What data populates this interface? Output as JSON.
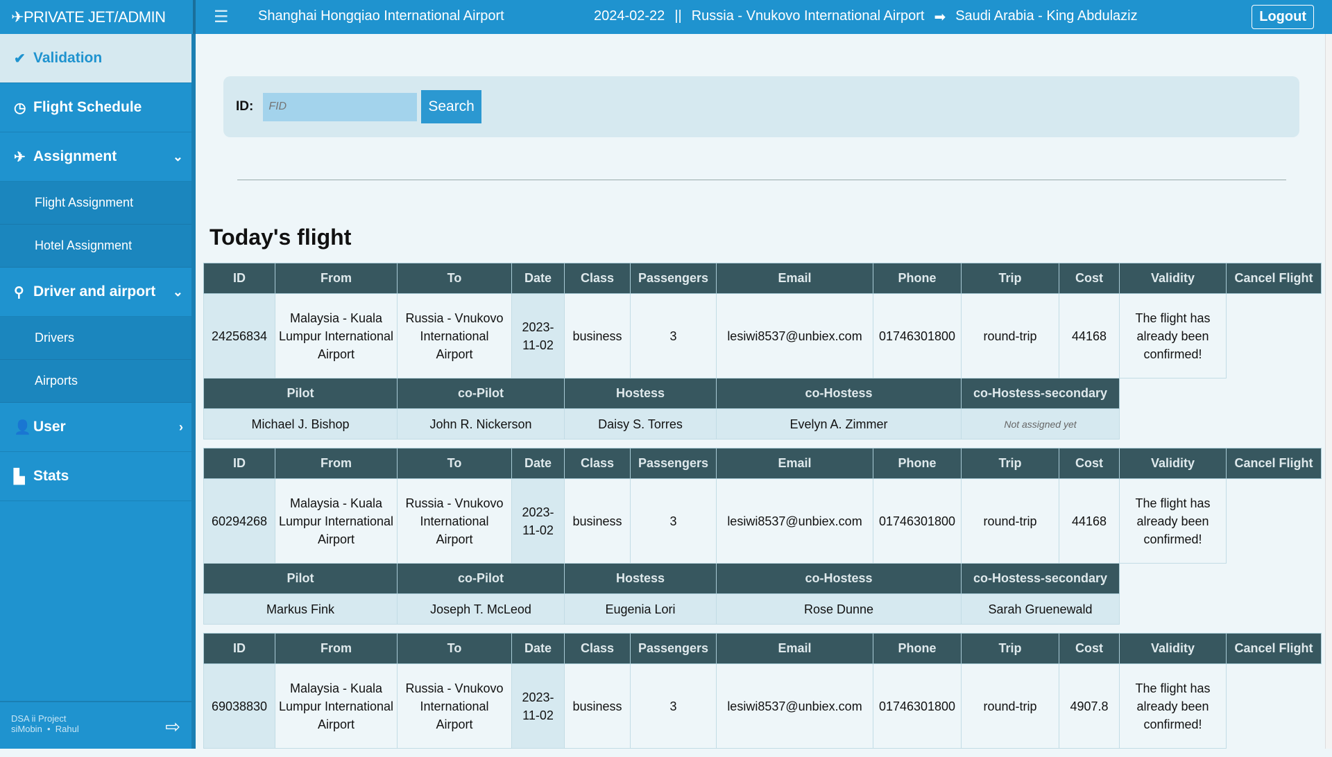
{
  "header": {
    "brand": "PRIVATE JET/ADMIN",
    "brand_icon": "plane-lock-icon",
    "menu_icon": "hamburger-icon",
    "departure": "Shanghai Hongqiao International Airport",
    "date": "2024-02-22",
    "separator": "||",
    "origin": "Russia - Vnukovo International Airport",
    "arrow": "➡",
    "destination": "Saudi Arabia - King Abdulaziz",
    "logout": "Logout"
  },
  "sidebar": {
    "items": [
      {
        "label": "Validation",
        "icon": "check-circle-icon",
        "active": true
      },
      {
        "label": "Flight Schedule",
        "icon": "clock-icon"
      },
      {
        "label": "Assignment",
        "icon": "plane-icon",
        "chevron": "⌄",
        "subitems": [
          "Flight Assignment",
          "Hotel Assignment"
        ]
      },
      {
        "label": "Driver and airport",
        "icon": "map-pin-icon",
        "chevron": "⌄",
        "subitems": [
          "Drivers",
          "Airports"
        ]
      },
      {
        "label": "User",
        "icon": "user-icon",
        "chevron": "›"
      },
      {
        "label": "Stats",
        "icon": "chart-icon"
      }
    ],
    "footer": {
      "project": "DSA ii Project",
      "authors": "siMobin  •  Rahul",
      "icon": "sign-out-icon"
    }
  },
  "search": {
    "label": "ID:",
    "placeholder": "FID",
    "button": "Search"
  },
  "section_title": "Today's flight",
  "columns": [
    "ID",
    "From",
    "To",
    "Date",
    "Class",
    "Passengers",
    "Email",
    "Phone",
    "Trip",
    "Cost",
    "Validity",
    "Cancel Flight"
  ],
  "crew_columns": [
    "Pilot",
    "co-Pilot",
    "Hostess",
    "co-Hostess",
    "co-Hostess-secondary"
  ],
  "flights": [
    {
      "cells": [
        "24256834",
        "Malaysia - Kuala Lumpur International Airport",
        "Russia - Vnukovo International Airport",
        "2023-11-02",
        "business",
        "3",
        "lesiwi8537@unbiex.com",
        "01746301800",
        "round-trip",
        "44168",
        "The flight has already been confirmed!"
      ],
      "crew": [
        "Michael J. Bishop",
        "John R. Nickerson",
        "Daisy S. Torres",
        "Evelyn A. Zimmer",
        "Not assigned yet"
      ]
    },
    {
      "cells": [
        "60294268",
        "Malaysia - Kuala Lumpur International Airport",
        "Russia - Vnukovo International Airport",
        "2023-11-02",
        "business",
        "3",
        "lesiwi8537@unbiex.com",
        "01746301800",
        "round-trip",
        "44168",
        "The flight has already been confirmed!"
      ],
      "crew": [
        "Markus Fink",
        "Joseph T. McLeod",
        "Eugenia Lori",
        "Rose Dunne",
        "Sarah Gruenewald"
      ]
    },
    {
      "cells": [
        "69038830",
        "Malaysia - Kuala Lumpur International Airport",
        "Russia - Vnukovo International Airport",
        "2023-11-02",
        "business",
        "3",
        "lesiwi8537@unbiex.com",
        "01746301800",
        "round-trip",
        "4907.8",
        "The flight has already been confirmed!"
      ]
    }
  ]
}
